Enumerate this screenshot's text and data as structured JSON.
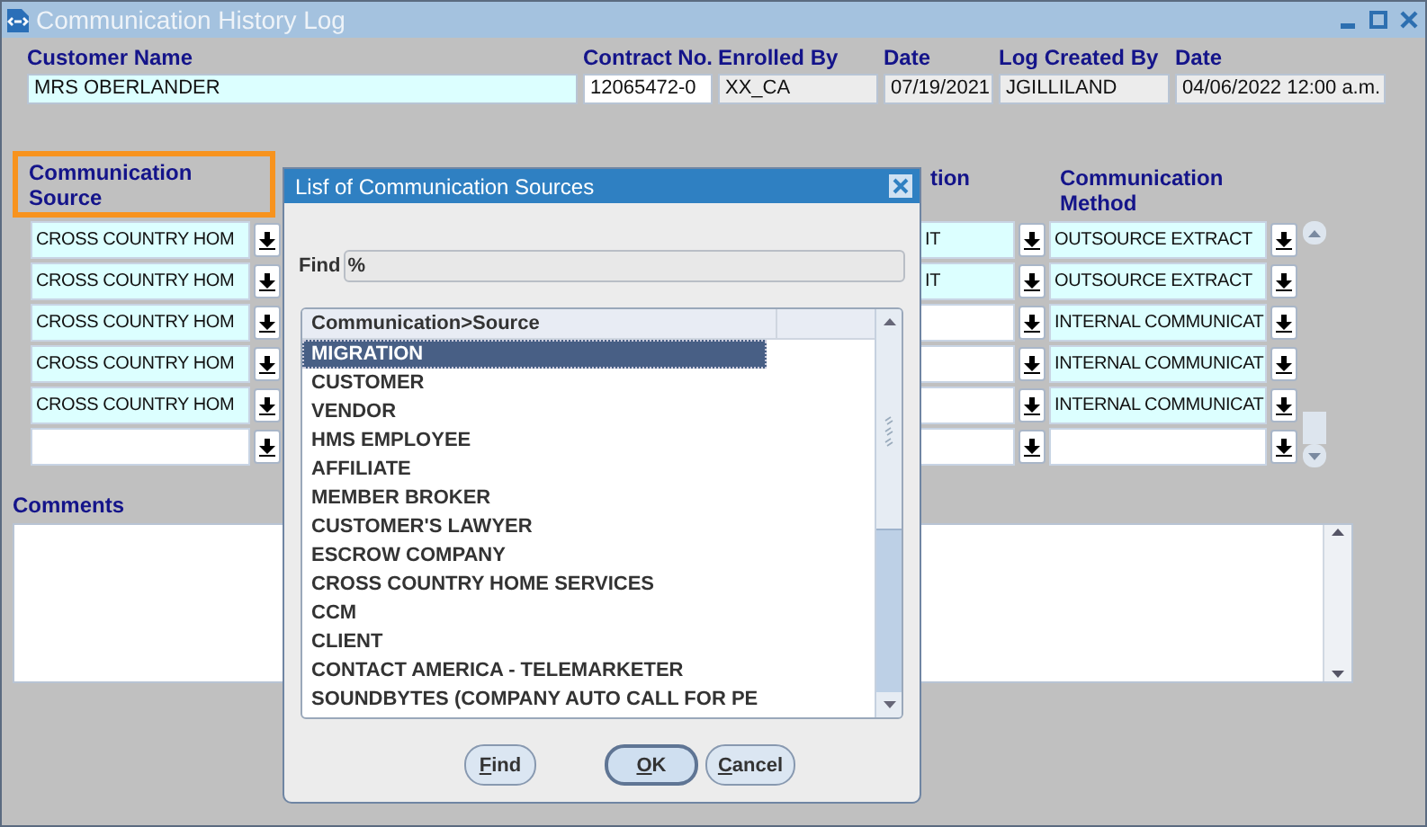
{
  "window": {
    "title": "Communication History Log"
  },
  "header": {
    "fields": [
      {
        "label": "Customer Name",
        "value": "MRS OBERLANDER",
        "kind": "editable"
      },
      {
        "label": "Contract No.",
        "value": "12065472-0",
        "kind": "plain"
      },
      {
        "label": "Enrolled By",
        "value": "XX_CA",
        "kind": "readonly"
      },
      {
        "label": "Date",
        "value": "07/19/2021",
        "kind": "readonly"
      },
      {
        "label": "Log Created By",
        "value": "JGILLILAND",
        "kind": "readonly"
      },
      {
        "label": "Date",
        "value": "04/06/2022 12:00 a.m.",
        "kind": "readonly"
      }
    ]
  },
  "table": {
    "columns": [
      {
        "label": "Communication Source",
        "highlighted": true
      },
      {
        "label": "tion",
        "highlighted": false
      },
      {
        "label": "Communication Method",
        "highlighted": false
      }
    ],
    "rows": [
      {
        "source": "CROSS COUNTRY HOM",
        "column_2": "IT",
        "method": "OUTSOURCE EXTRACT"
      },
      {
        "source": "CROSS COUNTRY HOM",
        "column_2": "IT",
        "method": "OUTSOURCE EXTRACT"
      },
      {
        "source": "CROSS COUNTRY HOM",
        "method": "INTERNAL COMMUNICAT"
      },
      {
        "source": "CROSS COUNTRY HOM",
        "method": "INTERNAL COMMUNICAT"
      },
      {
        "source": "CROSS COUNTRY HOM",
        "method": "INTERNAL COMMUNICAT"
      },
      {}
    ]
  },
  "comments": {
    "label": "Comments"
  },
  "dialog": {
    "title": "Lisf of Communication Sources",
    "find_label": "Find",
    "find_value": "%",
    "list_header": "Communication>Source",
    "items": [
      {
        "label": "MIGRATION",
        "selected": true
      },
      {
        "label": "CUSTOMER",
        "selected": false
      },
      {
        "label": "VENDOR",
        "selected": false
      },
      {
        "label": "HMS EMPLOYEE",
        "selected": false
      },
      {
        "label": "AFFILIATE",
        "selected": false
      },
      {
        "label": "MEMBER BROKER",
        "selected": false
      },
      {
        "label": "CUSTOMER'S LAWYER",
        "selected": false
      },
      {
        "label": "ESCROW COMPANY",
        "selected": false
      },
      {
        "label": "CROSS COUNTRY HOME SERVICES",
        "selected": false
      },
      {
        "label": "CCM",
        "selected": false
      },
      {
        "label": "CLIENT",
        "selected": false
      },
      {
        "label": "CONTACT AMERICA - TELEMARKETER",
        "selected": false
      },
      {
        "label": "SOUNDBYTES (COMPANY AUTO CALL FOR PE",
        "selected": false
      }
    ],
    "buttons": [
      {
        "label": "Find",
        "default": false,
        "mnemonic": true
      },
      {
        "label": "OK",
        "default": true,
        "mnemonic": true
      },
      {
        "label": "Cancel",
        "default": false,
        "mnemonic": true
      }
    ]
  }
}
